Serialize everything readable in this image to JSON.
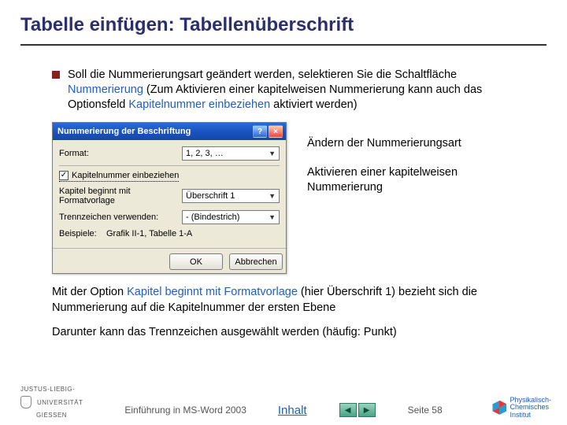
{
  "title": "Tabelle einfügen: Tabellenüberschrift",
  "bullet": {
    "pre": "Soll die Nummerierungsart geändert werden, selektieren Sie die Schaltfläche ",
    "kw1": "Nummerierung",
    "mid": " (Zum Aktivieren einer kapitelweisen Nummerierung kann auch das Optionsfeld ",
    "kw2": "Kapitelnummer einbeziehen",
    "post": " aktiviert werden)"
  },
  "dialog": {
    "title": "Nummerierung der Beschriftung",
    "format_label": "Format:",
    "format_value": "1, 2, 3, …",
    "checkbox_label": "Kapitelnummer einbeziehen",
    "checkbox_checked": true,
    "chapter_label": "Kapitel beginnt mit Formatvorlage",
    "chapter_value": "Überschrift 1",
    "sep_label": "Trennzeichen verwenden:",
    "sep_value": "- (Bindestrich)",
    "example_label": "Beispiele:",
    "example_value": "Grafik II-1, Tabelle 1-A",
    "ok": "OK",
    "cancel": "Abbrechen"
  },
  "side": {
    "note1": "Ändern der Nummerierungsart",
    "note2": "Aktivieren einer kapitelweisen Nummerierung"
  },
  "para1": {
    "pre": "Mit der Option ",
    "kw": "Kapitel beginnt mit Formatvorlage",
    "post": " (hier Überschrift 1) bezieht sich die Nummerierung auf die Kapitelnummer der ersten Ebene"
  },
  "para2": "Darunter kann das Trennzeichen ausgewählt werden (häufig: Punkt)",
  "footer": {
    "uni1": "JUSTUS-LIEBIG-",
    "uni2": "UNIVERSITÄT",
    "uni3": "GIESSEN",
    "course": "Einführung in MS-Word 2003",
    "toc": "Inhalt",
    "page": "Seite 58",
    "inst1": "Physikalisch-",
    "inst2": "Chemisches",
    "inst3": "Institut"
  }
}
